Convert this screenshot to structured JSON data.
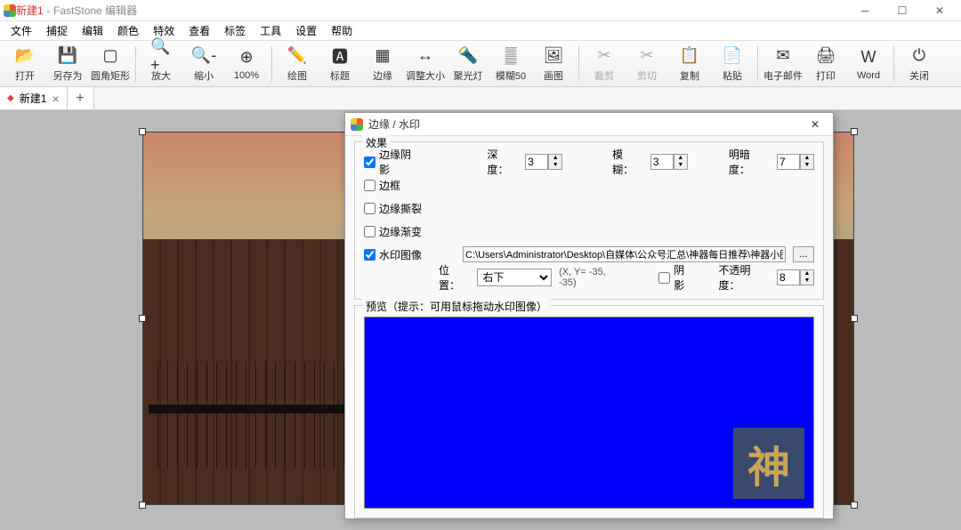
{
  "titlebar": {
    "filename": "新建1",
    "app": "FastStone 编辑器"
  },
  "menus": [
    "文件",
    "捕捉",
    "编辑",
    "颜色",
    "特效",
    "查看",
    "标签",
    "工具",
    "设置",
    "帮助"
  ],
  "toolbar": [
    {
      "id": "open",
      "label": "打开",
      "sep": false
    },
    {
      "id": "saveas",
      "label": "另存为",
      "sep": false
    },
    {
      "id": "roundrect",
      "label": "圆角矩形",
      "sep": true
    },
    {
      "id": "zoomin",
      "label": "放大",
      "sep": false
    },
    {
      "id": "zoomout",
      "label": "缩小",
      "sep": false
    },
    {
      "id": "zoom100",
      "label": "100%",
      "sep": true
    },
    {
      "id": "draw",
      "label": "绘图",
      "sep": false
    },
    {
      "id": "caption",
      "label": "标题",
      "sep": false
    },
    {
      "id": "edge",
      "label": "边缘",
      "sep": false
    },
    {
      "id": "resize",
      "label": "调整大小",
      "sep": false
    },
    {
      "id": "spotlight",
      "label": "聚光灯",
      "sep": false
    },
    {
      "id": "blur",
      "label": "模糊50",
      "sep": false
    },
    {
      "id": "gallery",
      "label": "画图",
      "sep": true
    },
    {
      "id": "crop",
      "label": "裁剪",
      "sep": false,
      "disabled": true
    },
    {
      "id": "cut",
      "label": "剪切",
      "sep": false,
      "disabled": true
    },
    {
      "id": "copy",
      "label": "复制",
      "sep": false
    },
    {
      "id": "paste",
      "label": "粘贴",
      "sep": true
    },
    {
      "id": "email",
      "label": "电子邮件",
      "sep": false
    },
    {
      "id": "print",
      "label": "打印",
      "sep": false
    },
    {
      "id": "word",
      "label": "Word",
      "sep": true
    },
    {
      "id": "close",
      "label": "关闭",
      "sep": false
    }
  ],
  "tab": {
    "name": "新建1"
  },
  "dialog": {
    "title": "边缘 / 水印",
    "effects_legend": "效果",
    "chk_edge_shadow": "边缘阴影",
    "depth_label": "深度：",
    "depth_val": "3",
    "blur_label": "模糊：",
    "blur_val": "3",
    "brightness_label": "明暗度：",
    "brightness_val": "7",
    "chk_border": "边框",
    "chk_torn": "边缘撕裂",
    "chk_fade": "边缘渐变",
    "chk_watermark": "水印图像",
    "wm_path": "C:\\Users\\Administrator\\Desktop\\自媒体\\公众号汇总\\神器每日推荐\\神器小图",
    "pos_label": "位置：",
    "pos_value": "右下",
    "coords": "(X, Y= -35, -35)",
    "chk_shadow": "阴影",
    "opacity_label": "不透明度：",
    "opacity_val": "8",
    "preview_legend": "预览（提示：可用鼠标拖动水印图像）",
    "wm_char": "神"
  }
}
